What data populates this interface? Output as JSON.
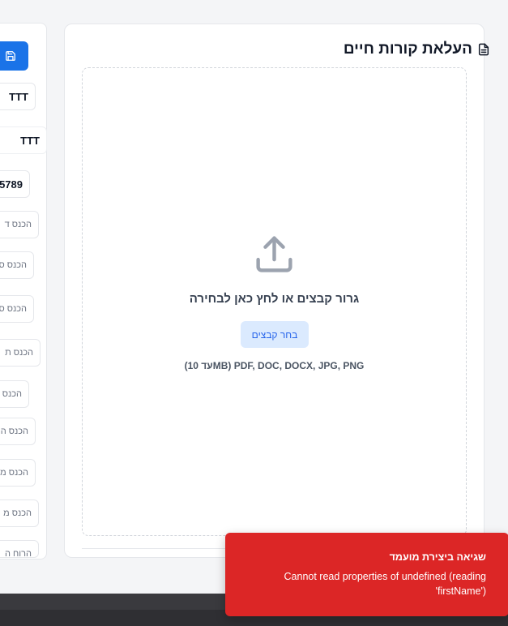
{
  "left_form": {
    "field_values": [
      "TTT",
      "TTT",
      "5789"
    ],
    "placeholders": [
      "הכנס ד",
      "הכנס ס",
      "הכנס ס",
      "הכנס ת",
      "הכנס",
      "הכנס ה",
      "הכנס מ",
      "הכנס מ",
      "הרוח ה"
    ]
  },
  "upload": {
    "title": "העלאת קורות חיים",
    "drop_text": "גרור קבצים או לחץ כאן לבחירה",
    "choose_label": "בחר קבצים",
    "formats_text": "(עד 10MB) PDF, DOC, DOCX, JPG, PNG"
  },
  "toast": {
    "title": "שגיאה ביצירת מועמד",
    "message": "Cannot read properties of undefined (reading 'firstName')"
  },
  "colors": {
    "primary": "#1a73e8",
    "error": "#dc2626",
    "choose_bg": "#dbeafe"
  }
}
